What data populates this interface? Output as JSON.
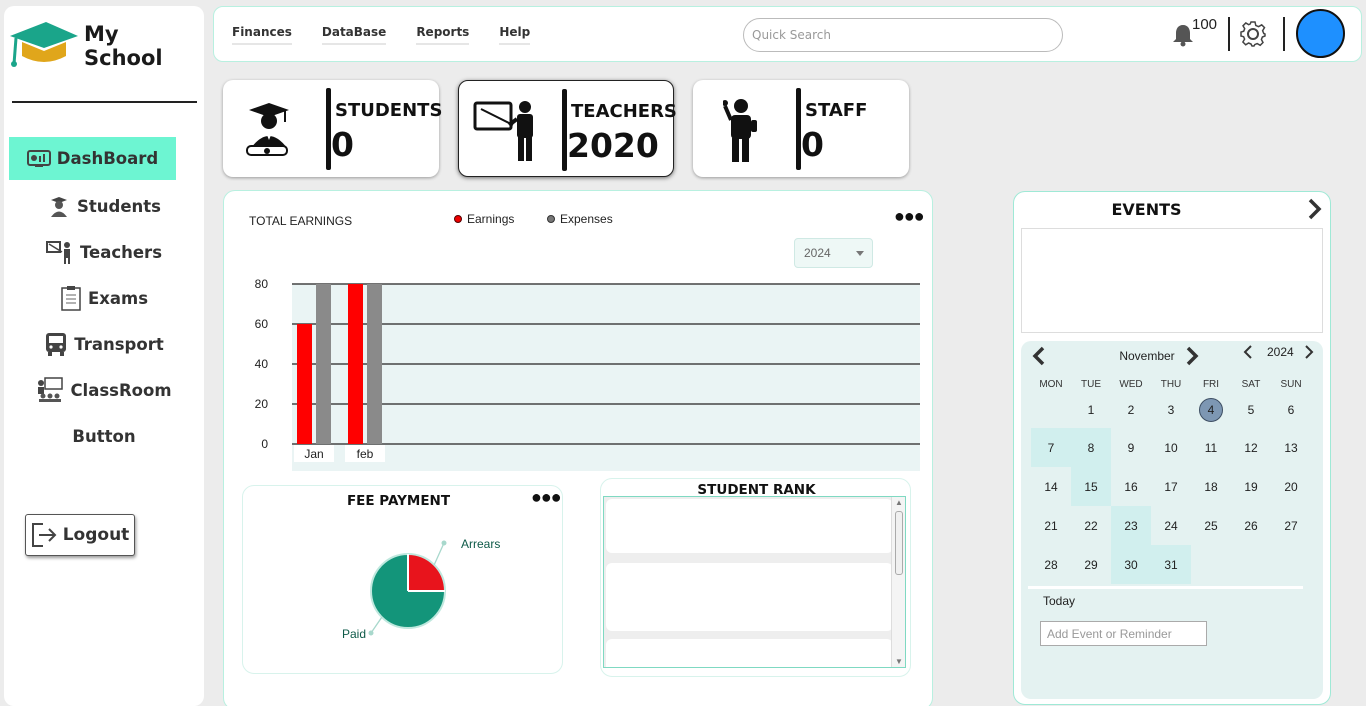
{
  "app": {
    "title": "My School"
  },
  "sidebar": {
    "items": [
      {
        "label": "DashBoard",
        "icon": "dashboard-icon",
        "active": true
      },
      {
        "label": "Students",
        "icon": "student-icon"
      },
      {
        "label": "Teachers",
        "icon": "teacher-icon"
      },
      {
        "label": "Exams",
        "icon": "exam-icon"
      },
      {
        "label": "Transport",
        "icon": "bus-icon"
      },
      {
        "label": "ClassRoom",
        "icon": "classroom-icon"
      },
      {
        "label": "Button",
        "icon": ""
      }
    ],
    "logout_label": "Logout"
  },
  "topbar": {
    "menu": [
      "Finances",
      "DataBase",
      "Reports",
      "Help"
    ],
    "search_placeholder": "Quick Search",
    "notification_count": "100"
  },
  "stats": [
    {
      "label": "STUDENTS",
      "value": "0",
      "icon": "graduate-icon"
    },
    {
      "label": "TEACHERS",
      "value": "2020",
      "icon": "teacher-board-icon"
    },
    {
      "label": "STAFF",
      "value": "0",
      "icon": "staff-icon"
    }
  ],
  "earnings": {
    "title": "TOTAL EARNINGS",
    "year": "2024"
  },
  "chart_data": [
    {
      "type": "bar",
      "categories": [
        "Jan",
        "feb"
      ],
      "series": [
        {
          "name": "Earnings",
          "values": [
            60,
            80
          ],
          "color": "#ff0000"
        },
        {
          "name": "Expenses",
          "values": [
            80,
            80
          ],
          "color": "#8a8a8a"
        }
      ],
      "ylim": [
        0,
        80
      ],
      "yticks": [
        0,
        20,
        40,
        60,
        80
      ],
      "grid": true,
      "legend": "top"
    },
    {
      "type": "pie",
      "title": "FEE PAYMENT",
      "labels": [
        "Arrears",
        "Paid"
      ],
      "values": [
        25,
        75
      ],
      "colors": [
        "#e8141c",
        "#13957a"
      ]
    }
  ],
  "student_rank": {
    "title": "STUDENT RANK"
  },
  "events": {
    "title": "EVENTS",
    "month": "November",
    "year": "2024",
    "weekdays": [
      "MON",
      "TUE",
      "WED",
      "THU",
      "FRI",
      "SAT",
      "SUN"
    ],
    "first_weekday_offset": 1,
    "days_in_month": 30,
    "extra_day": "31",
    "selected_day": 4,
    "highlighted_days": [
      7,
      8,
      15,
      23,
      30,
      31
    ],
    "today_label": "Today",
    "add_placeholder": "Add Event or Reminder"
  },
  "colors": {
    "accent": "#6df5d2",
    "border": "#b8f0e0",
    "avatar": "#1e90ff"
  }
}
